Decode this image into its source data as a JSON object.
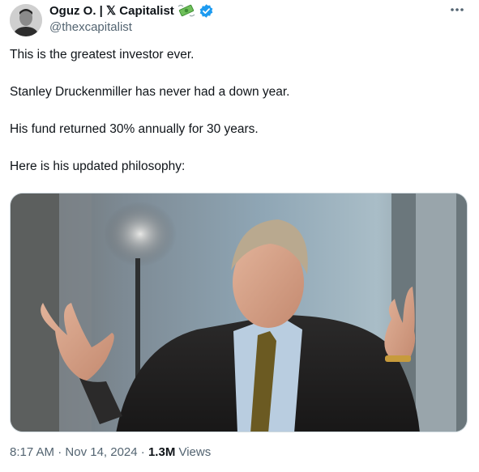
{
  "author": {
    "display_name": "Oguz O. | ",
    "x_mark": "𝕏",
    "brand_word": " Capitalist",
    "handle": "@thexcapitalist",
    "verified_color": "#1d9bf0"
  },
  "icons": {
    "more": "more-horizontal-icon",
    "money": "money-with-wings-icon",
    "verified": "verified-badge-icon"
  },
  "tweet": {
    "paragraphs": [
      "This is the greatest investor ever.",
      "Stanley Druckenmiller has never had a down year.",
      "His fund returned 30% annually for 30 years.",
      "Here is his updated philosophy:"
    ]
  },
  "meta": {
    "time": "8:17 AM",
    "sep1": " · ",
    "date": "Nov 14, 2024",
    "sep2": " · ",
    "views_count": "1.3M",
    "views_label": " Views"
  }
}
